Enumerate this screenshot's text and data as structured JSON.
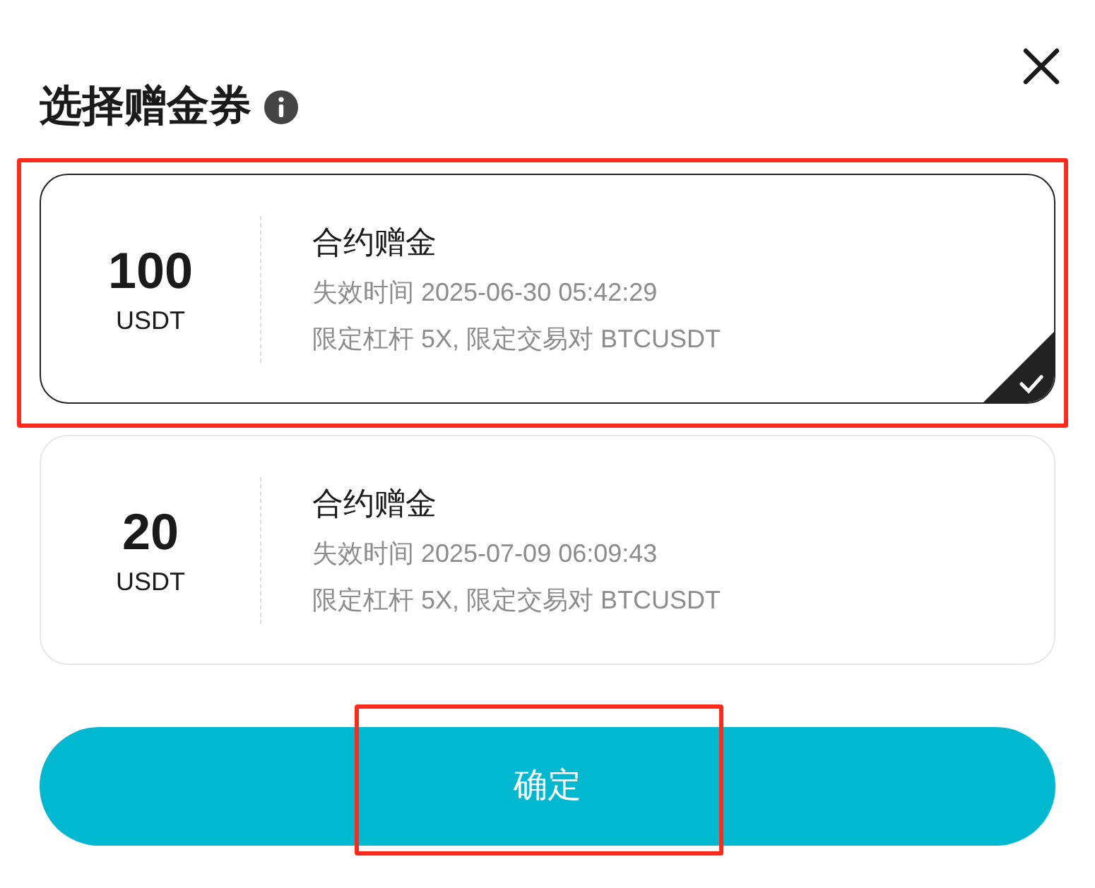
{
  "title": "选择赠金券",
  "coupons": [
    {
      "amount": "100",
      "unit": "USDT",
      "name": "合约赠金",
      "expiry": "失效时间 2025-06-30 05:42:29",
      "limits": "限定杠杆 5X, 限定交易对 BTCUSDT",
      "selected": true
    },
    {
      "amount": "20",
      "unit": "USDT",
      "name": "合约赠金",
      "expiry": "失效时间 2025-07-09 06:09:43",
      "limits": "限定杠杆 5X, 限定交易对 BTCUSDT",
      "selected": false
    }
  ],
  "confirm_button": "确定"
}
